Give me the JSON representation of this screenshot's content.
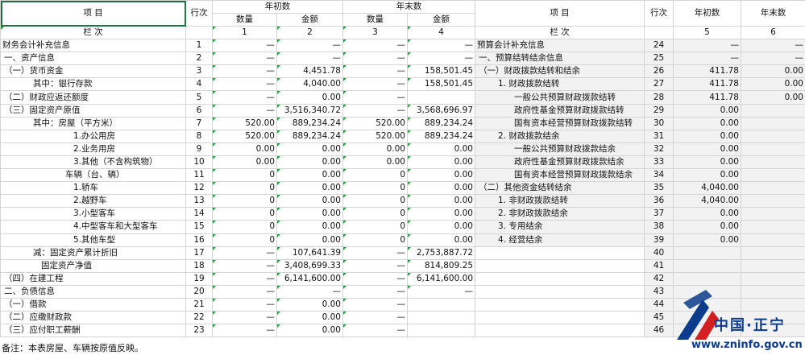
{
  "header": {
    "item": "项    目",
    "line_no": "行次",
    "begin": "年初数",
    "end": "年末数",
    "qty": "数量",
    "amt": "金额",
    "col_label": "栏    次",
    "col_nums_left": [
      "1",
      "2",
      "3",
      "4"
    ],
    "item_right": "项    目",
    "line_no_right": "行次",
    "begin_right": "年初数",
    "end_right": "年末数",
    "col_label_right": "栏    次",
    "col_nums_right": [
      "5",
      "6"
    ]
  },
  "rows": [
    {
      "li": "财务会计补充信息",
      "ln": "1",
      "q1": "—",
      "a1": "—",
      "q2": "—",
      "a2": "—",
      "ri": "预算会计补充信息",
      "rn": "24",
      "b": "—",
      "e": "—"
    },
    {
      "li": "一、资产信息",
      "ln": "2",
      "q1": "—",
      "a1": "—",
      "q2": "—",
      "a2": "—",
      "ri": "一、预算结转结余信息",
      "rn": "25",
      "b": "—",
      "e": "—"
    },
    {
      "li": "（一）货币资金",
      "ln": "3",
      "q1": "—",
      "a1": "4,451.78",
      "q2": "—",
      "a2": "158,501.45",
      "ri": "（一）财政拨款结转和结余",
      "rn": "26",
      "b": "411.78",
      "e": "0.00"
    },
    {
      "li": "其中：银行存款",
      "ln": "4",
      "q1": "—",
      "a1": "4,040.00",
      "q2": "—",
      "a2": "158,501.45",
      "ri": "1. 财政拨款结转",
      "rn": "27",
      "b": "411.78",
      "e": "0.00"
    },
    {
      "li": "（二）财政应返还额度",
      "ln": "5",
      "q1": "—",
      "a1": "0.00",
      "q2": "—",
      "a2": "",
      "ri": "一般公共预算财政拨款结转",
      "rn": "28",
      "b": "411.78",
      "e": "0.00"
    },
    {
      "li": "（三）固定资产原值",
      "ln": "6",
      "q1": "—",
      "a1": "3,516,340.72",
      "q2": "—",
      "a2": "3,568,696.97",
      "ri": "政府性基金预算财政拨款结转",
      "rn": "29",
      "b": "0.00",
      "e": ""
    },
    {
      "li": "其中：房屋（平方米）",
      "ln": "7",
      "q1": "520.00",
      "a1": "889,234.24",
      "q2": "520.00",
      "a2": "889,234.24",
      "ri": "国有资本经营预算财政拨款结转",
      "rn": "30",
      "b": "0.00",
      "e": ""
    },
    {
      "li": "1.办公用房",
      "ln": "8",
      "q1": "520.00",
      "a1": "889,234.24",
      "q2": "520.00",
      "a2": "889,234.24",
      "ri": "2. 财政拨款结余",
      "rn": "31",
      "b": "0.00",
      "e": ""
    },
    {
      "li": "2.业务用房",
      "ln": "9",
      "q1": "0.00",
      "a1": "0.00",
      "q2": "0.00",
      "a2": "0.00",
      "ri": "一般公共预算财政拨款结余",
      "rn": "32",
      "b": "0.00",
      "e": ""
    },
    {
      "li": "3.其他（不含构筑物）",
      "ln": "10",
      "q1": "0.00",
      "a1": "0.00",
      "q2": "0.00",
      "a2": "0.00",
      "ri": "政府性基金预算财政拨款结余",
      "rn": "33",
      "b": "0.00",
      "e": ""
    },
    {
      "li": "车辆（台、辆）",
      "ln": "11",
      "q1": "0",
      "a1": "0.00",
      "q2": "0",
      "a2": "0.00",
      "ri": "国有资本经营预算财政拨款结余",
      "rn": "34",
      "b": "0.00",
      "e": ""
    },
    {
      "li": "1.轿车",
      "ln": "12",
      "q1": "0",
      "a1": "0.00",
      "q2": "0",
      "a2": "0.00",
      "ri": "（二）其他资金结转结余",
      "rn": "35",
      "b": "4,040.00",
      "e": ""
    },
    {
      "li": "2.越野车",
      "ln": "13",
      "q1": "0",
      "a1": "0.00",
      "q2": "0",
      "a2": "0.00",
      "ri": "1. 非财政拨款结转",
      "rn": "36",
      "b": "4,040.00",
      "e": ""
    },
    {
      "li": "3.小型客车",
      "ln": "14",
      "q1": "0",
      "a1": "0.00",
      "q2": "0",
      "a2": "0.00",
      "ri": "2. 非财政拨款结余",
      "rn": "37",
      "b": "0.00",
      "e": ""
    },
    {
      "li": "4.中型客车和大型客车",
      "ln": "15",
      "q1": "0",
      "a1": "0.00",
      "q2": "0",
      "a2": "0.00",
      "ri": "3. 专用结余",
      "rn": "38",
      "b": "0.00",
      "e": ""
    },
    {
      "li": "5.其他车型",
      "ln": "16",
      "q1": "0",
      "a1": "0.00",
      "q2": "0",
      "a2": "0.00",
      "ri": "4. 经营结余",
      "rn": "39",
      "b": "0.00",
      "e": ""
    },
    {
      "li": "减：固定资产累计折旧",
      "ln": "17",
      "q1": "—",
      "a1": "107,641.39",
      "q2": "—",
      "a2": "2,753,887.72",
      "ri": "",
      "rn": "40",
      "b": "",
      "e": ""
    },
    {
      "li": "固定资产净值",
      "ln": "18",
      "q1": "—",
      "a1": "3,408,699.33",
      "q2": "—",
      "a2": "814,809.25",
      "ri": "",
      "rn": "41",
      "b": "",
      "e": ""
    },
    {
      "li": "（四）在建工程",
      "ln": "19",
      "q1": "—",
      "a1": "6,141,600.00",
      "q2": "—",
      "a2": "6,141,600.00",
      "ri": "",
      "rn": "42",
      "b": "",
      "e": ""
    },
    {
      "li": "二、负债信息",
      "ln": "20",
      "q1": "—",
      "a1": "—",
      "q2": "—",
      "a2": "—",
      "ri": "",
      "rn": "43",
      "b": "",
      "e": ""
    },
    {
      "li": "（一）借款",
      "ln": "21",
      "q1": "—",
      "a1": "0.00",
      "q2": "—",
      "a2": "",
      "ri": "",
      "rn": "44",
      "b": "",
      "e": ""
    },
    {
      "li": "（二）应缴财政款",
      "ln": "22",
      "q1": "—",
      "a1": "0.00",
      "q2": "—",
      "a2": "",
      "ri": "",
      "rn": "45",
      "b": "",
      "e": ""
    },
    {
      "li": "（三）应付职工薪酬",
      "ln": "23",
      "q1": "—",
      "a1": "0.00",
      "q2": "—",
      "a2": "",
      "ri": "",
      "rn": "46",
      "b": "",
      "e": ""
    }
  ],
  "footer": {
    "note": "备注：本表房屋、车辆按原值反映。"
  },
  "watermark": {
    "name": "中国·正宁",
    "url": "www.zninfo.gov.cn",
    "color": "#0c3c8c",
    "accent": "#d42020"
  }
}
